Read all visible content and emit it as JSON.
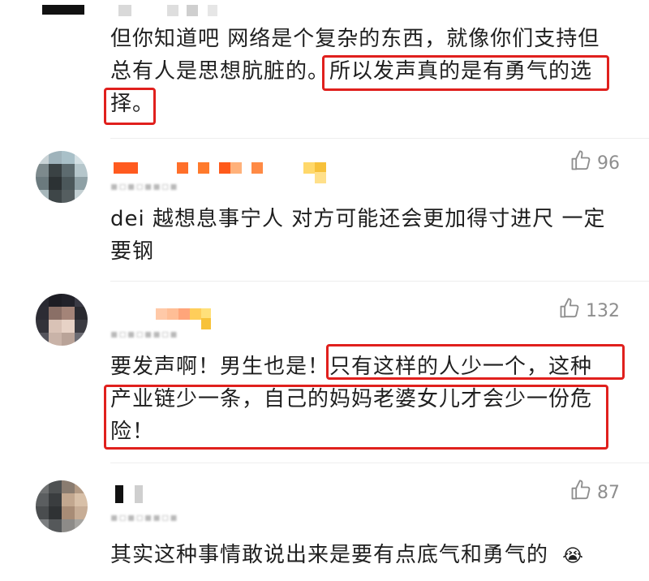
{
  "comments": [
    {
      "text_lines": [
        "但你知道吧 网络是个复杂的东西，就像你们支持但",
        "总有人是思想肮脏的。所以发声真的是有勇气的选",
        "择。"
      ]
    },
    {
      "likes": "96",
      "text_lines": [
        "dei 越想息事宁人 对方可能还会更加得寸进尺 一定",
        "要钢"
      ]
    },
    {
      "likes": "132",
      "text_lines": [
        "要发声啊！男生也是！只有这样的人少一个，这种",
        "产业链少一条，自己的妈妈老婆女儿才会少一份危",
        "险！"
      ]
    },
    {
      "likes": "87",
      "text_lines": [
        "其实这种事情敢说出来是要有点底气和勇气的"
      ],
      "emoji": "😭"
    }
  ],
  "colors": {
    "highlight": "#e0201d",
    "like_icon": "#8e8e8e"
  },
  "icons": {
    "like": "thumbs-up-icon"
  }
}
